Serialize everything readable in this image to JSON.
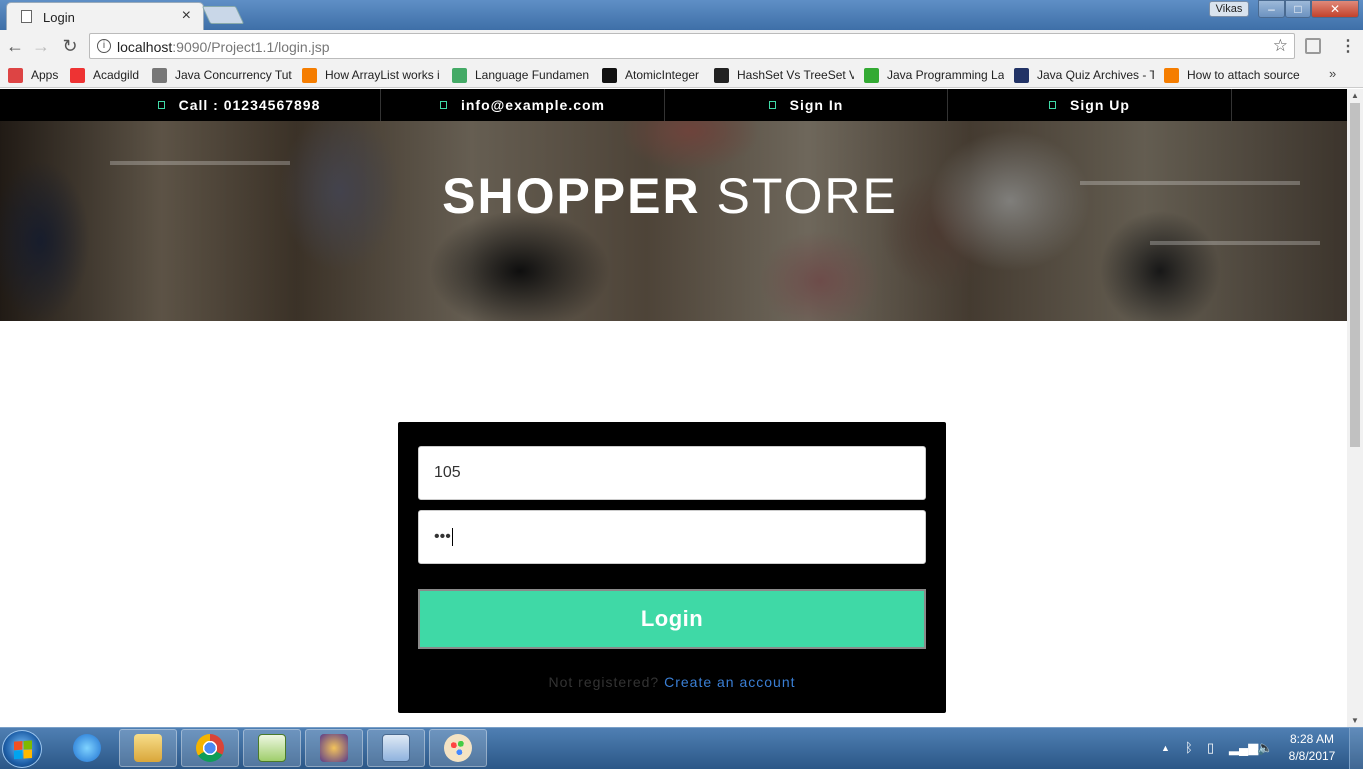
{
  "browser": {
    "tab_title": "Login",
    "tab_close": "×",
    "user": "Vikas",
    "url_host": "localhost",
    "url_rest": ":9090/Project1.1/login.jsp",
    "window_controls": {
      "minimize": "–",
      "maximize": "□",
      "close": "✕"
    }
  },
  "bookmarks": [
    {
      "label": "Apps",
      "icon": "apps-grid-icon",
      "color": "#d44"
    },
    {
      "label": "Acadgild",
      "icon": "acadgild-icon",
      "color": "#e33"
    },
    {
      "label": "Java Concurrency Tut",
      "icon": "diamond-icon",
      "color": "#777"
    },
    {
      "label": "How ArrayList works i",
      "icon": "blogger-icon",
      "color": "#f57d00"
    },
    {
      "label": "Language Fundamen",
      "icon": "figure-icon",
      "color": "#4a6"
    },
    {
      "label": "AtomicInteger",
      "icon": "j-icon",
      "color": "#111"
    },
    {
      "label": "HashSet Vs TreeSet V",
      "icon": "dark-square-icon",
      "color": "#222"
    },
    {
      "label": "Java Programming La",
      "icon": "link-icon",
      "color": "#3a3"
    },
    {
      "label": "Java Quiz Archives - T",
      "icon": "quiz-icon",
      "color": "#236"
    },
    {
      "label": "How to attach source",
      "icon": "blogger-icon",
      "color": "#f57d00"
    }
  ],
  "bookmarks_more": "»",
  "topbar": {
    "call": "Call : 01234567898",
    "email": "info@example.com",
    "sign_in": "Sign In",
    "sign_up": "Sign Up"
  },
  "hero": {
    "title_bold": "SHOPPER",
    "title_light": "STORE"
  },
  "login": {
    "username_value": "105",
    "password_mask": "•••",
    "button": "Login",
    "register_question": "Not registered?",
    "register_link": "Create an account"
  },
  "taskbar": {
    "time": "8:28 AM",
    "date": "8/8/2017",
    "apps": [
      "internet-explorer-icon",
      "file-explorer-icon",
      "chrome-icon",
      "notepad-plus-plus-icon",
      "java-ee-ide-icon",
      "media-player-icon",
      "paint-icon"
    ]
  }
}
